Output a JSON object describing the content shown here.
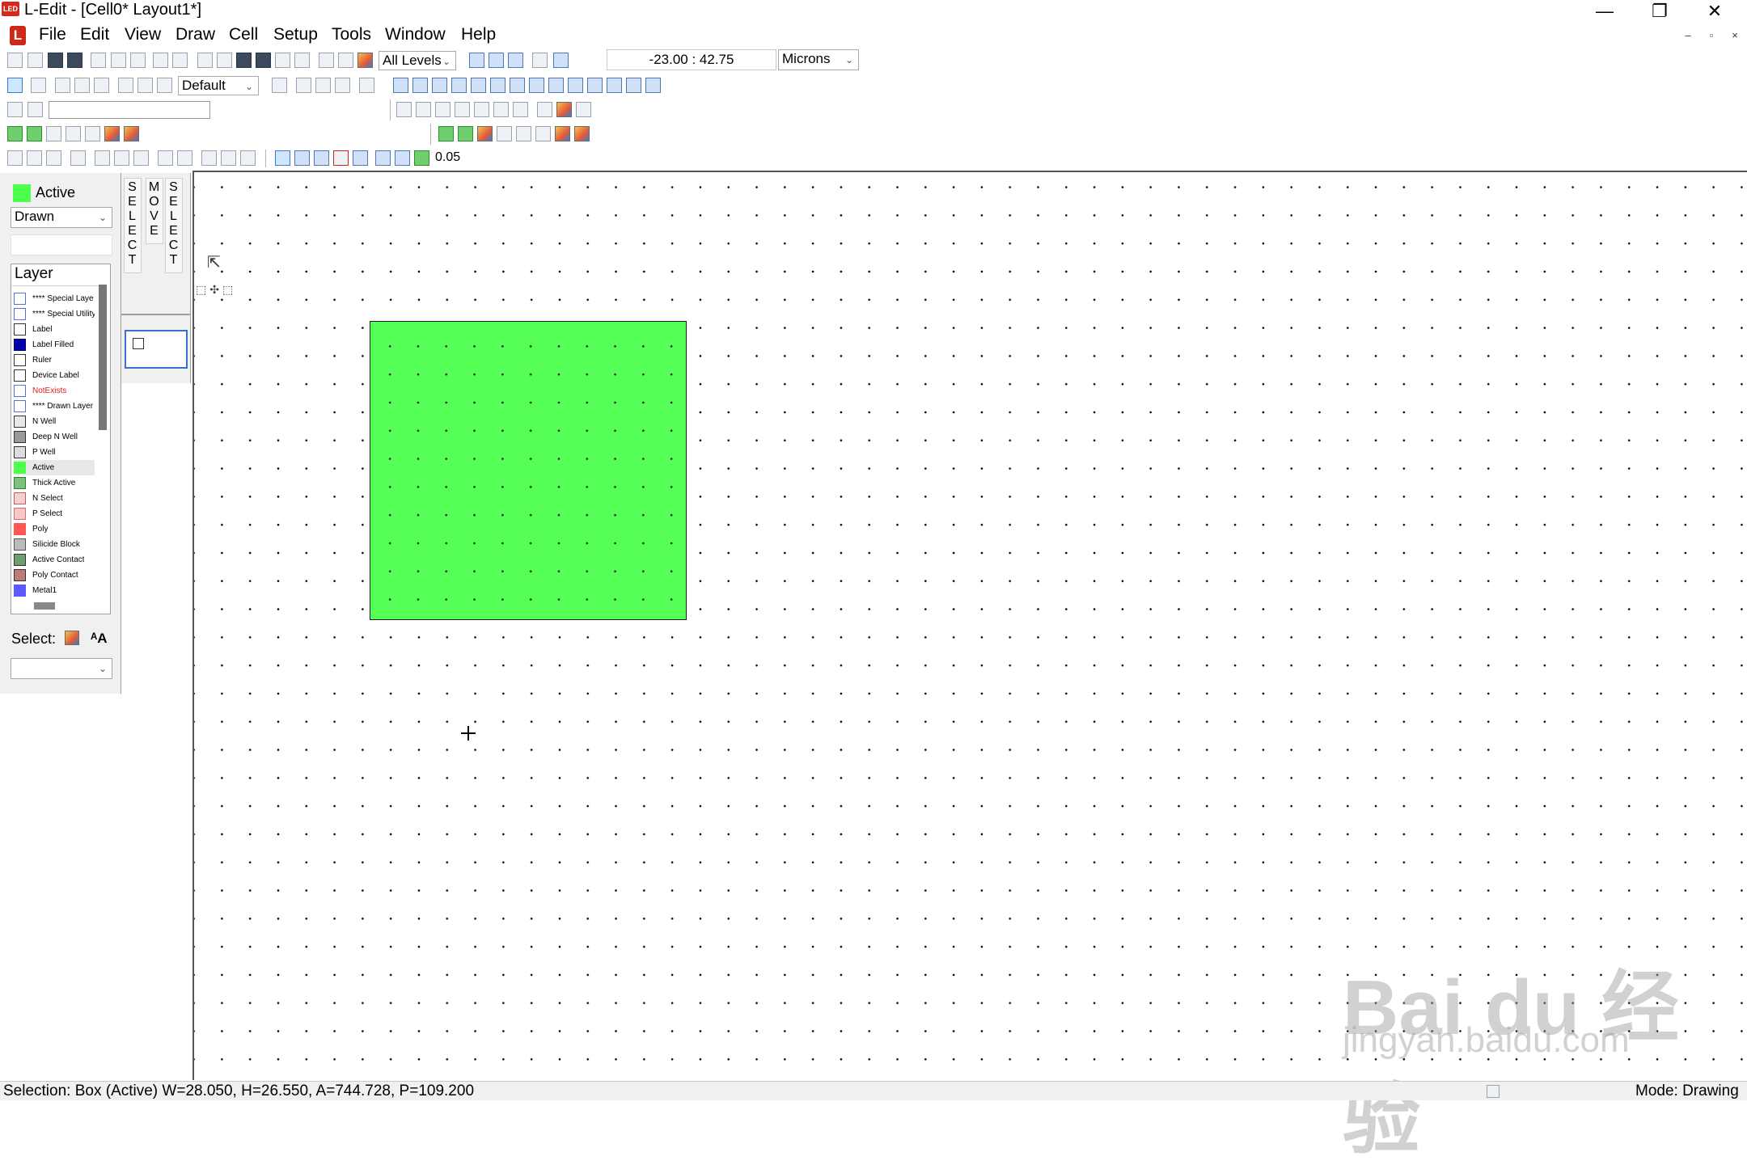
{
  "window": {
    "app_badge": "LED",
    "title": "L-Edit - [Cell0*      Layout1*]",
    "controls": [
      "—",
      "❐",
      "✕"
    ]
  },
  "menu": {
    "logo": "L",
    "items": [
      "File",
      "Edit",
      "View",
      "Draw",
      "Cell",
      "Setup",
      "Tools",
      "Window",
      "Help"
    ],
    "mdi_controls": [
      "–",
      "▫",
      "×"
    ]
  },
  "toolbar": {
    "levels_select": "All Levels",
    "coordinates": "-23.00 : 42.75",
    "units_select": "Microns",
    "style_select": "Default",
    "grid_value": "0.05"
  },
  "left_panel": {
    "current_layer": "Active",
    "current_layer_color": "#4dff4d",
    "drawn_select": "Drawn",
    "layer_header": "Layer",
    "layers": [
      {
        "name": "**** Special Laye",
        "color": "#ffffff",
        "border": "#5b6fd6",
        "text_color": "#000000"
      },
      {
        "name": "**** Special Utility",
        "color": "#ffffff",
        "border": "#5b6fd6",
        "text_color": "#000000"
      },
      {
        "name": "Label",
        "color": "#ffffff",
        "border": "#333333",
        "text_color": "#000000"
      },
      {
        "name": "Label Filled",
        "color": "#0000b0",
        "border": "#000060",
        "text_color": "#000000"
      },
      {
        "name": "Ruler",
        "color": "#ffffff",
        "border": "#333333",
        "text_color": "#000000"
      },
      {
        "name": "Device Label",
        "color": "#ffffff",
        "border": "#333333",
        "text_color": "#000000"
      },
      {
        "name": "NotExists",
        "color": "#ffffff",
        "border": "#5b6fd6",
        "text_color": "#e02020"
      },
      {
        "name": "**** Drawn Layer",
        "color": "#ffffff",
        "border": "#5b6fd6",
        "text_color": "#000000"
      },
      {
        "name": "N Well",
        "color": "#e8e8e8",
        "border": "#333333",
        "text_color": "#000000"
      },
      {
        "name": "Deep N Well",
        "color": "#9a9a9a",
        "border": "#333333",
        "text_color": "#000000"
      },
      {
        "name": "P Well",
        "color": "#dcdcdc",
        "border": "#333333",
        "text_color": "#000000"
      },
      {
        "name": "Active",
        "color": "#4dff4d",
        "border": "#4dff4d",
        "text_color": "#000000"
      },
      {
        "name": "Thick Active",
        "color": "#7fbf7f",
        "border": "#2f7f2f",
        "text_color": "#000000"
      },
      {
        "name": "N Select",
        "color": "#f4d0d0",
        "border": "#c06060",
        "text_color": "#000000"
      },
      {
        "name": "P Select",
        "color": "#f7c8c8",
        "border": "#d07070",
        "text_color": "#000000"
      },
      {
        "name": "Poly",
        "color": "#ff5555",
        "border": "#ff5555",
        "text_color": "#000000"
      },
      {
        "name": "Silicide Block",
        "color": "#bbbbbb",
        "border": "#555555",
        "text_color": "#000000"
      },
      {
        "name": "Active Contact",
        "color": "#6f9f6f",
        "border": "#333333",
        "text_color": "#000000"
      },
      {
        "name": "Poly Contact",
        "color": "#c07a7a",
        "border": "#333333",
        "text_color": "#000000"
      },
      {
        "name": "Metal1",
        "color": "#5a5aff",
        "border": "#5a5aff",
        "text_color": "#000000"
      }
    ],
    "select_label": "Select:",
    "select_combo": ""
  },
  "mode_panel": {
    "left": "S\nE\nL\nE\nC\nT",
    "middle": "M\nO\nV\nE",
    "right": "S\nE\nL\nE\nC\nT"
  },
  "status": {
    "selection": "Selection: Box (Active) W=28.050, H=26.550, A=744.728, P=109.200",
    "mode": "Mode: Drawing"
  },
  "watermark": {
    "brand": "Bai du 经验",
    "url": "jingyan.baidu.com"
  }
}
